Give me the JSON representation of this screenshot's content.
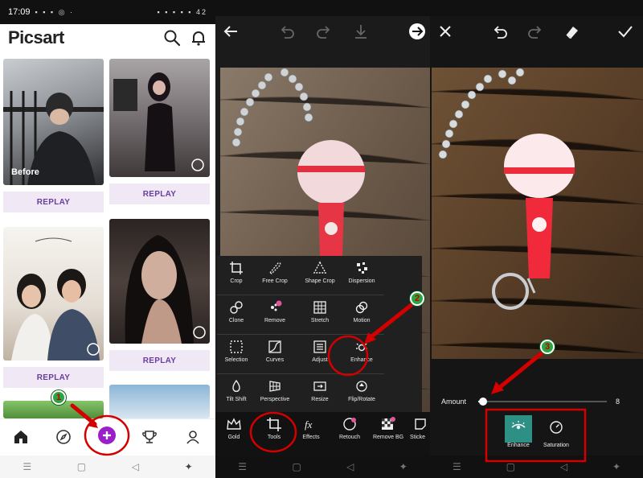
{
  "status_bar": {
    "time": "17:09",
    "left_icons": "▪ ▪ ▪ ◎ ·",
    "right_icons": "▪ ▪ ▪ ▪ ▪ 42"
  },
  "left_screen": {
    "app_name": "Picsart",
    "search_icon": "search-icon",
    "notifications_icon": "bell-icon",
    "feed": [
      {
        "overlay_label": "Before",
        "button_label": "REPLAY"
      },
      {
        "overlay_label": "",
        "button_label": "REPLAY"
      },
      {
        "overlay_label": "",
        "button_label": "REPLAY"
      },
      {
        "overlay_label": "",
        "button_label": "REPLAY"
      }
    ],
    "bottom_nav": [
      "home-icon",
      "compass-icon",
      "plus-icon",
      "trophy-icon",
      "profile-icon"
    ]
  },
  "middle_screen": {
    "tools": [
      [
        "Crop",
        "Free Crop",
        "Shape Crop",
        "Dispersion"
      ],
      [
        "Clone",
        "Remove",
        "Stretch",
        "Motion"
      ],
      [
        "Selection",
        "Curves",
        "Adjust",
        "Enhance"
      ],
      [
        "Tilt Shift",
        "Perspective",
        "Resize",
        "Flip/Rotate"
      ]
    ],
    "toolbar": [
      "Gold",
      "Tools",
      "Effects",
      "Retouch",
      "Remove BG",
      "Sticke"
    ]
  },
  "right_screen": {
    "amount_label": "Amount",
    "amount_value": "8",
    "amount_slider_fraction": 0.04,
    "sub_tools": [
      "Enhance",
      "Saturation"
    ]
  },
  "callouts": [
    "1",
    "2",
    "3"
  ],
  "colors": {
    "accent_purple": "#9b1fc8",
    "annotation_red": "#d40000",
    "selected_teal": "#2e8f84",
    "replay_bg": "#f1e8f6"
  }
}
